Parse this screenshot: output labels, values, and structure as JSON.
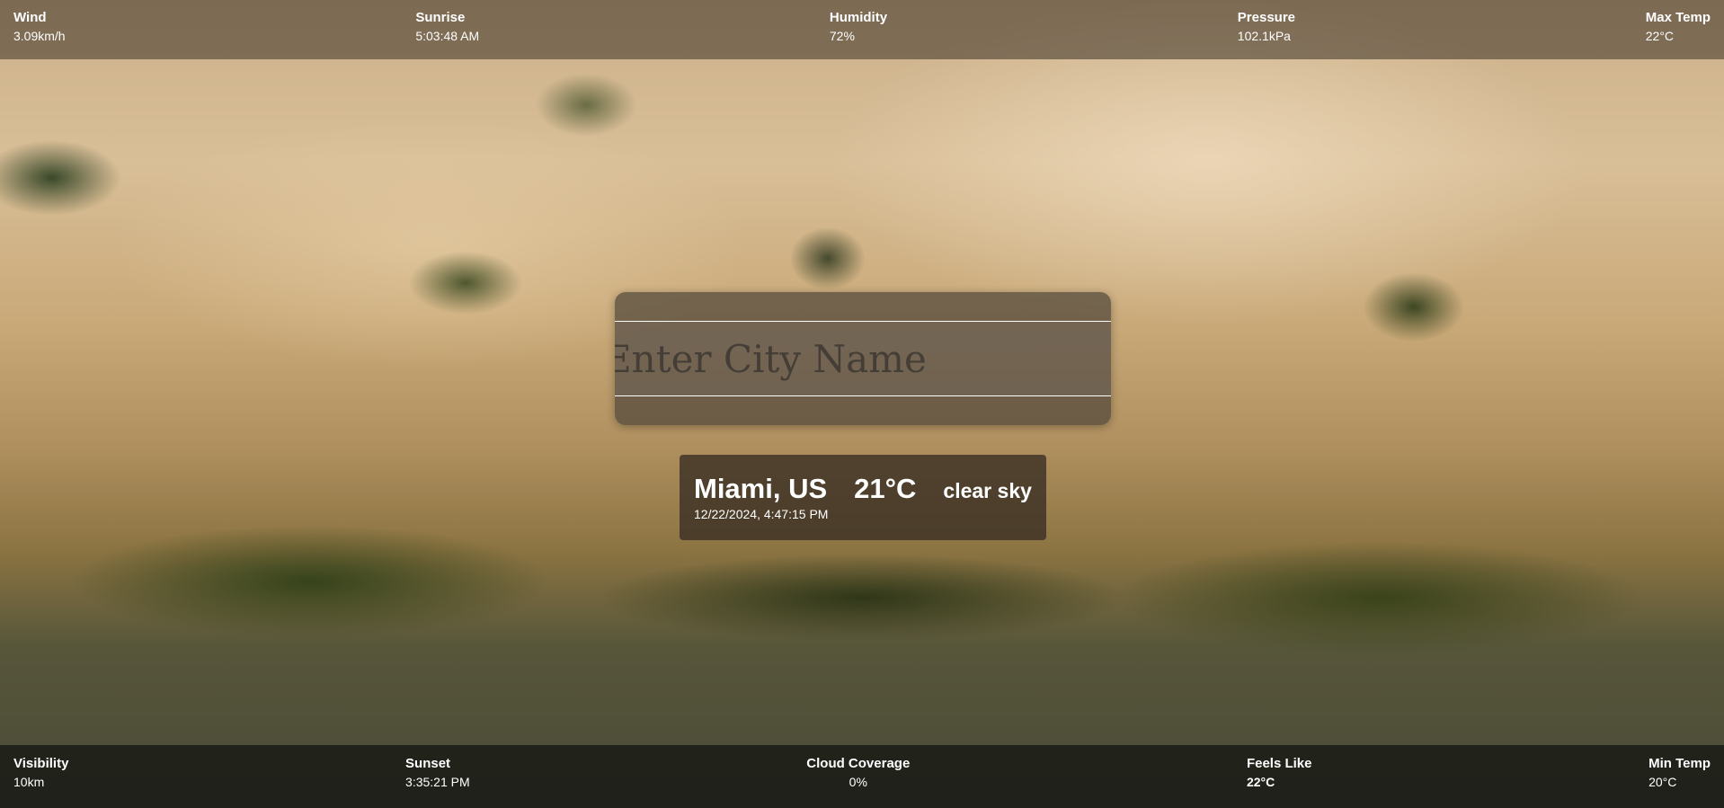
{
  "top_stats": [
    {
      "label": "Wind",
      "value": "3.09km/h"
    },
    {
      "label": "Sunrise",
      "value": "5:03:48 AM"
    },
    {
      "label": "Humidity",
      "value": "72%"
    },
    {
      "label": "Pressure",
      "value": "102.1kPa"
    },
    {
      "label": "Max Temp",
      "value": "22°C"
    }
  ],
  "bottom_stats": [
    {
      "label": "Visibility",
      "value": "10km"
    },
    {
      "label": "Sunset",
      "value": "3:35:21 PM"
    },
    {
      "label": "Cloud Coverage",
      "value": "0%"
    },
    {
      "label": "Feels Like",
      "value": "22°C"
    },
    {
      "label": "Min Temp",
      "value": "20°C"
    }
  ],
  "search": {
    "placeholder": "Enter City Name",
    "value": ""
  },
  "weather": {
    "city": "Miami, US",
    "temperature": "21°C",
    "description": "clear sky",
    "datetime": "12/22/2024, 4:47:15 PM"
  }
}
